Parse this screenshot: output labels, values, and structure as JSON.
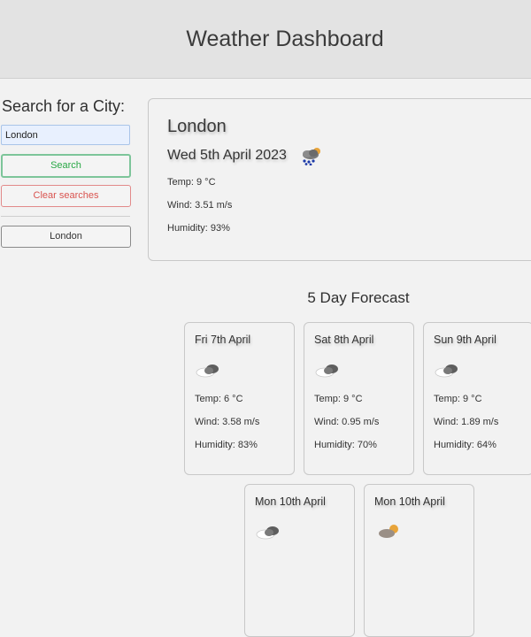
{
  "header": {
    "title": "Weather Dashboard"
  },
  "search": {
    "heading": "Search for a City:",
    "input_value": "London",
    "search_label": "Search",
    "clear_label": "Clear searches",
    "history": [
      "London"
    ]
  },
  "current": {
    "city": "London",
    "date": "Wed 5th April 2023",
    "icon": "rain-cloud-icon",
    "temp": "Temp: 9 °C",
    "wind": "Wind: 3.51 m/s",
    "humidity": "Humidity: 93%"
  },
  "forecast": {
    "title": "5 Day Forecast",
    "days": [
      {
        "date": "Fri 7th April",
        "icon": "cloud-icon",
        "temp": "Temp: 6 °C",
        "wind": "Wind: 3.58 m/s",
        "humidity": "Humidity: 83%"
      },
      {
        "date": "Sat 8th April",
        "icon": "cloud-icon",
        "temp": "Temp: 9 °C",
        "wind": "Wind: 0.95 m/s",
        "humidity": "Humidity: 70%"
      },
      {
        "date": "Sun 9th April",
        "icon": "cloud-icon",
        "temp": "Temp: 9 °C",
        "wind": "Wind: 1.89 m/s",
        "humidity": "Humidity: 64%"
      },
      {
        "date": "Mon 10th April",
        "icon": "cloud-icon"
      },
      {
        "date": "Mon 10th April",
        "icon": "sun-cloud-icon"
      }
    ]
  }
}
